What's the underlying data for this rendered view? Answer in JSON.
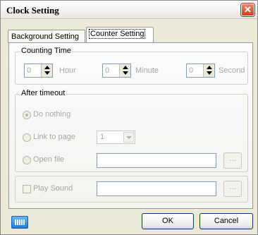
{
  "window": {
    "title": "Clock Setting",
    "close_glyph": "✕"
  },
  "tabs": [
    {
      "label": "Background Setting",
      "active": false
    },
    {
      "label": "Counter Setting",
      "active": true
    }
  ],
  "counting_time": {
    "legend": "Counting Time",
    "hour": {
      "value": "0",
      "label": "Hour"
    },
    "minute": {
      "value": "0",
      "label": "Minute"
    },
    "second": {
      "value": "0",
      "label": "Second"
    }
  },
  "after_timeout": {
    "legend": "After timeout",
    "options": [
      {
        "label": "Do nothing",
        "checked": true
      },
      {
        "label": "Link to page",
        "checked": false
      },
      {
        "label": "Open file",
        "checked": false
      }
    ],
    "page_select": {
      "value": "1"
    },
    "open_file_path": "",
    "browse_label": "..."
  },
  "sound": {
    "label": "Play Sound",
    "checked": false,
    "path": "",
    "browse_label": "..."
  },
  "footer": {
    "keyboard_icon": "keyboard-icon",
    "ok_label": "OK",
    "cancel_label": "Cancel"
  },
  "colors": {
    "dialog_bg": "#ece9d8",
    "close_red": "#c8421f",
    "disabled_text": "#a6a6a6",
    "keyboard_blue": "#1d7fd8"
  }
}
